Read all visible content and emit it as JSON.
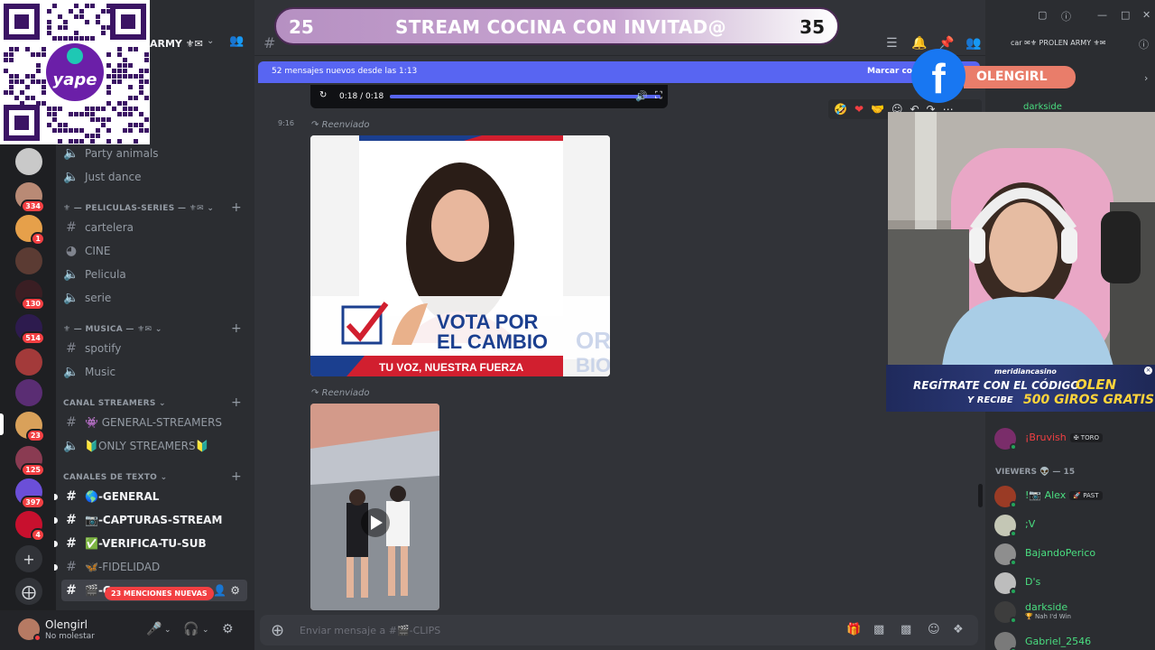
{
  "rail": {
    "badges": [
      "334",
      "1",
      "130",
      "514",
      "23",
      "125",
      "397",
      "4"
    ]
  },
  "guild": {
    "name": "ARMY ⚜✉"
  },
  "sidebar": {
    "top_channels": [
      {
        "label": "Party animals",
        "icon": "speaker-icon"
      },
      {
        "label": "Just dance",
        "icon": "speaker-icon"
      }
    ],
    "categories": [
      {
        "label": "⚜ — PELICULAS-SERIES — ⚜✉",
        "channels": [
          {
            "label": "cartelera",
            "icon": "#"
          },
          {
            "label": "CINE",
            "icon": "stage-icon"
          },
          {
            "label": "Pelicula",
            "icon": "speaker-icon"
          },
          {
            "label": "serie",
            "icon": "speaker-icon"
          }
        ]
      },
      {
        "label": "⚜ — MUSICA — ⚜✉",
        "channels": [
          {
            "label": "spotify",
            "icon": "#"
          },
          {
            "label": "Music",
            "icon": "speaker-icon"
          }
        ]
      },
      {
        "label": "CANAL STREAMERS",
        "channels": [
          {
            "label": "👾 GENERAL-STREAMERS",
            "icon": "#"
          },
          {
            "label": "🔰ONLY STREAMERS🔰",
            "icon": "speaker-icon"
          }
        ]
      },
      {
        "label": "CANALES DE TEXTO",
        "channels": [
          {
            "label": "🌎-GENERAL",
            "icon": "#"
          },
          {
            "label": "📷-CAPTURAS-STREAM",
            "icon": "#"
          },
          {
            "label": "✅-VERIFICA-TU-SUB",
            "icon": "#"
          },
          {
            "label": "🦋-FIDELIDAD",
            "icon": "#"
          },
          {
            "label": "🎬-C",
            "icon": "#"
          }
        ]
      }
    ],
    "mentions_pill": "23 MENCIONES NUEVAS"
  },
  "user_panel": {
    "name": "Olengirl",
    "status": "No molestar"
  },
  "chat": {
    "new_messages_bar": "52 mensajes nuevos desde las 1:13",
    "mark_read": "Marcar co",
    "video_time": "0:18 / 0:18",
    "video_progress": 1.0,
    "message_time": "9:16",
    "forwarded_label": "Reenviado",
    "poster": {
      "headline_1": "VOTA POR",
      "headline_2": "EL CAMBIO",
      "tagline": "TU VOZ, NUESTRA FUERZA",
      "ghost_1": "OR",
      "ghost_2": "BIO"
    },
    "composer_placeholder": "Enviar mensaje a #🎬-CLIPS"
  },
  "members": {
    "top_partial": "darkside",
    "top_role_members": [
      {
        "name": "¡Bruvish",
        "tag": "✠ TORO",
        "color": "#f23f42"
      }
    ],
    "viewers_header": "VIEWERS 👽 — 15",
    "viewers": [
      {
        "name": "!📷 Alex",
        "tag": "🚀 PAST",
        "sub": "",
        "color": "#4ade80"
      },
      {
        "name": ";V",
        "tag": "",
        "sub": "",
        "color": "#4ade80"
      },
      {
        "name": "BajandoPerico",
        "tag": "",
        "sub": "",
        "color": "#4ade80"
      },
      {
        "name": "D's",
        "tag": "",
        "sub": "",
        "color": "#4ade80"
      },
      {
        "name": "darkside",
        "tag": "",
        "sub": "🏆 Nah I'd Win",
        "color": "#4ade80"
      },
      {
        "name": "Gabriel_2546",
        "tag": "",
        "sub": "",
        "color": "#4ade80"
      }
    ],
    "header_partial": "car ✉⚜ PROLEN ARMY ⚜✉"
  },
  "overlay": {
    "banner_left": "25",
    "banner_title": "STREAM COCINA CON INVITAD@",
    "banner_right": "35",
    "fb_name": "OLENGIRL",
    "qr_text": "yape",
    "casino_brand": "meridiancasino",
    "casino_line1": "REGÍTRATE CON EL CÓDIGO",
    "casino_code": "OLEN",
    "casino_line2": "Y RECIBE",
    "casino_spins": "500 GIROS GRATIS"
  },
  "colors": {
    "discord_blurple": "#5865f2",
    "mention_red": "#f23f42",
    "online_green": "#23a55a",
    "facebook_blue": "#1877f2"
  }
}
